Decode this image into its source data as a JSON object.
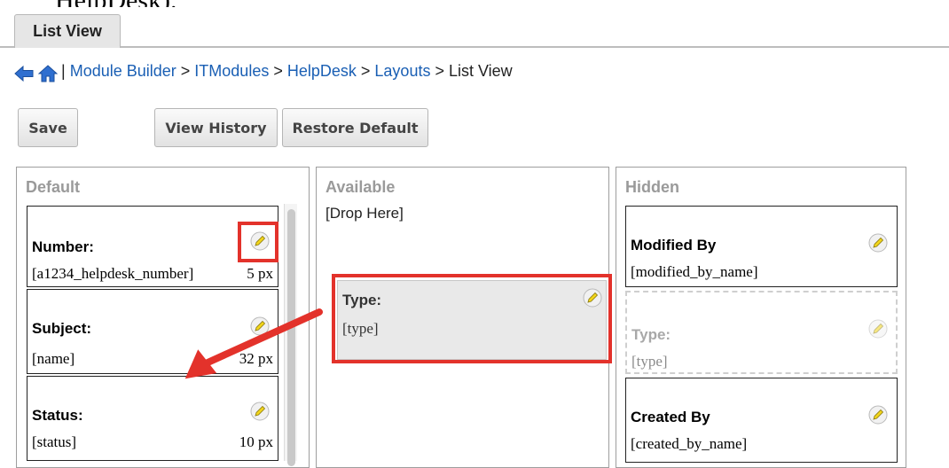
{
  "header_text": "HelpDesk).",
  "tab": {
    "label": "List View"
  },
  "breadcrumb": {
    "items": [
      {
        "label": "Module Builder",
        "link": true
      },
      {
        "label": "ITModules",
        "link": true
      },
      {
        "label": "HelpDesk",
        "link": true
      },
      {
        "label": "Layouts",
        "link": true
      },
      {
        "label": "List View",
        "link": false
      }
    ]
  },
  "toolbar": {
    "save_label": "Save",
    "history_label": "View History",
    "restore_label": "Restore Default"
  },
  "columns": {
    "default": {
      "heading": "Default",
      "cards": [
        {
          "label": "Number:",
          "field": "[a1234_helpdesk_number]",
          "width": "5 px"
        },
        {
          "label": "Subject:",
          "field": "[name]",
          "width": "32 px"
        },
        {
          "label": "Status:",
          "field": "[status]",
          "width": "10 px"
        }
      ]
    },
    "available": {
      "heading": "Available",
      "drop_label": "[Drop Here]",
      "dragged_card": {
        "label": "Type:",
        "field": "[type]"
      }
    },
    "hidden": {
      "heading": "Hidden",
      "cards": [
        {
          "label": "Modified By",
          "field": "[modified_by_name]"
        },
        {
          "label": "Type:",
          "field": "[type]"
        },
        {
          "label": "Created By",
          "field": "[created_by_name]"
        }
      ]
    }
  },
  "colors": {
    "link": "#1a5fb4",
    "highlight_red": "#e3322b",
    "heading_gray": "#9a9a9a",
    "pencil_yellow": "#f2d51a"
  },
  "icons": {
    "back": "back-arrow-icon",
    "home": "home-icon",
    "edit": "pencil-icon"
  }
}
